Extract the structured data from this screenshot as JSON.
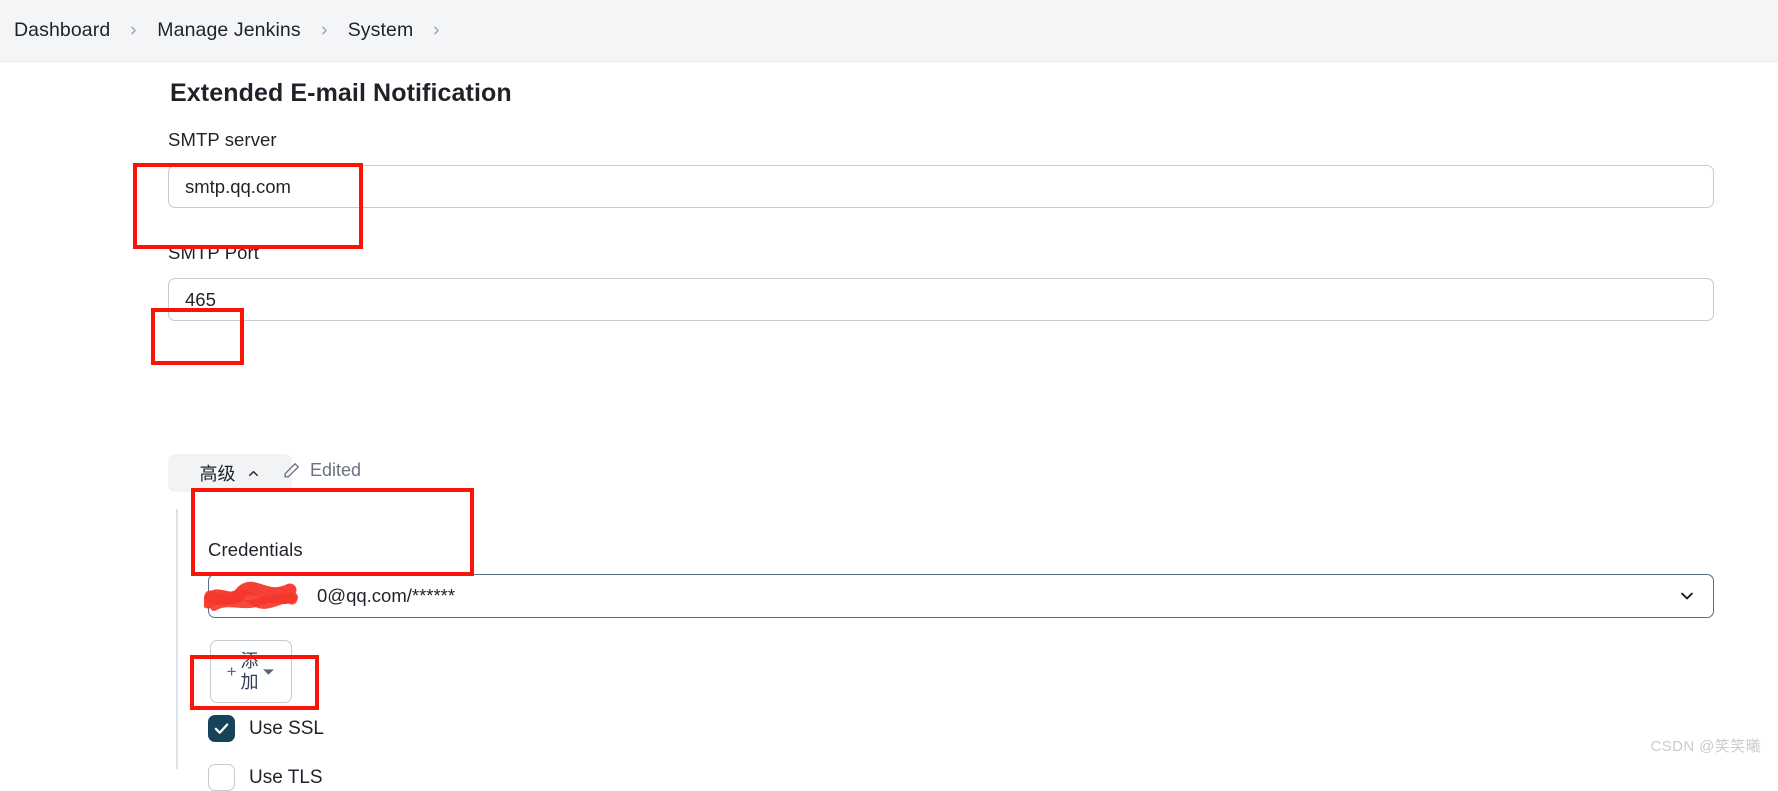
{
  "breadcrumb": {
    "items": [
      {
        "label": "Dashboard"
      },
      {
        "label": "Manage Jenkins"
      },
      {
        "label": "System"
      }
    ],
    "separator_icon": "chevron-right-icon"
  },
  "page": {
    "title": "Extended E-mail Notification"
  },
  "fields": {
    "smtp_server": {
      "label": "SMTP server",
      "value": "smtp.qq.com",
      "placeholder": ""
    },
    "smtp_port": {
      "label": "SMTP Port",
      "value": "465",
      "placeholder": ""
    },
    "credentials": {
      "label": "Credentials",
      "value": "0@qq.com/******",
      "chevron_icon": "chevron-down-icon"
    }
  },
  "advanced": {
    "toggle_label": "高级",
    "toggle_icon": "chevron-up-icon",
    "edited_label": "Edited",
    "edited_icon": "pencil-icon",
    "add_button": {
      "plus": "+",
      "label": "添加",
      "caret_icon": "caret-down-icon"
    },
    "checkboxes": [
      {
        "label": "Use SSL",
        "checked": true
      },
      {
        "label": "Use TLS",
        "checked": false
      }
    ]
  },
  "colors": {
    "breadcrumb_bg": "#f4f5f7",
    "annotation_red": "#fa1408",
    "checkbox_checked": "#16425b",
    "input_border": "#c3ccd3",
    "select_border": "#566f86",
    "muted_text": "#6b7280"
  },
  "watermark": {
    "text": "CSDN @笑笑曦"
  }
}
